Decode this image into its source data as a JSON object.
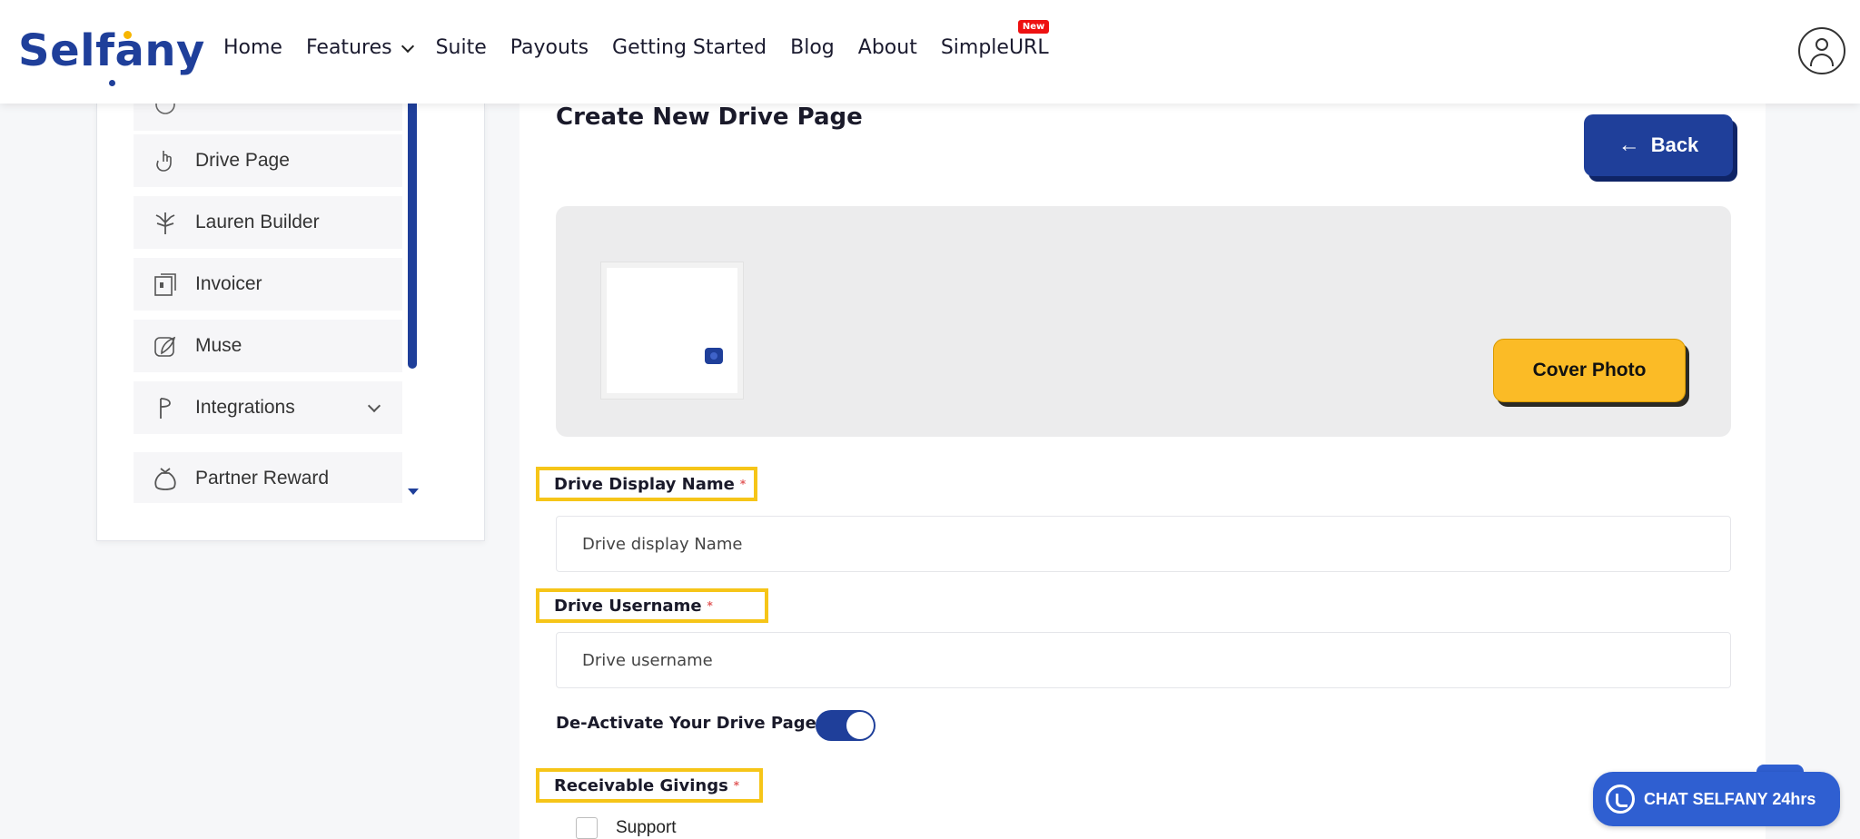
{
  "header": {
    "logo": "Selfany",
    "nav": [
      {
        "label": "Home"
      },
      {
        "label": "Features",
        "has_dropdown": true
      },
      {
        "label": "Suite"
      },
      {
        "label": "Payouts"
      },
      {
        "label": "Getting Started"
      },
      {
        "label": "Blog"
      },
      {
        "label": "About"
      },
      {
        "label": "SimpleURL",
        "badge": "New"
      }
    ]
  },
  "sidebar": {
    "items": [
      {
        "label": "Drive Page",
        "icon": "hand-pointer-icon"
      },
      {
        "label": "Lauren Builder",
        "icon": "tree-icon"
      },
      {
        "label": "Invoicer",
        "icon": "invoice-icon"
      },
      {
        "label": "Muse",
        "icon": "feather-icon"
      },
      {
        "label": "Integrations",
        "icon": "integration-icon",
        "has_dropdown": true
      },
      {
        "label": "Partner Reward",
        "icon": "money-bag-icon"
      }
    ]
  },
  "main": {
    "title": "Create New Drive Page",
    "back_label": "Back",
    "cover_button": "Cover Photo",
    "fields": {
      "display_name": {
        "label": "Drive Display Name",
        "required_mark": "*",
        "placeholder": "Drive display Name"
      },
      "username": {
        "label": "Drive Username",
        "required_mark": "*",
        "placeholder": "Drive username"
      }
    },
    "toggle": {
      "label": "De-Activate Your Drive Page",
      "state": "on"
    },
    "givings": {
      "label": "Receivable Givings",
      "required_mark": "*",
      "options": [
        {
          "label": "Support",
          "checked": false
        }
      ]
    }
  },
  "chat": {
    "label": "CHAT SELFANY 24hrs"
  },
  "colors": {
    "primary": "#1f3f9a",
    "accent": "#fbbb26",
    "highlight": "#f6c518"
  }
}
